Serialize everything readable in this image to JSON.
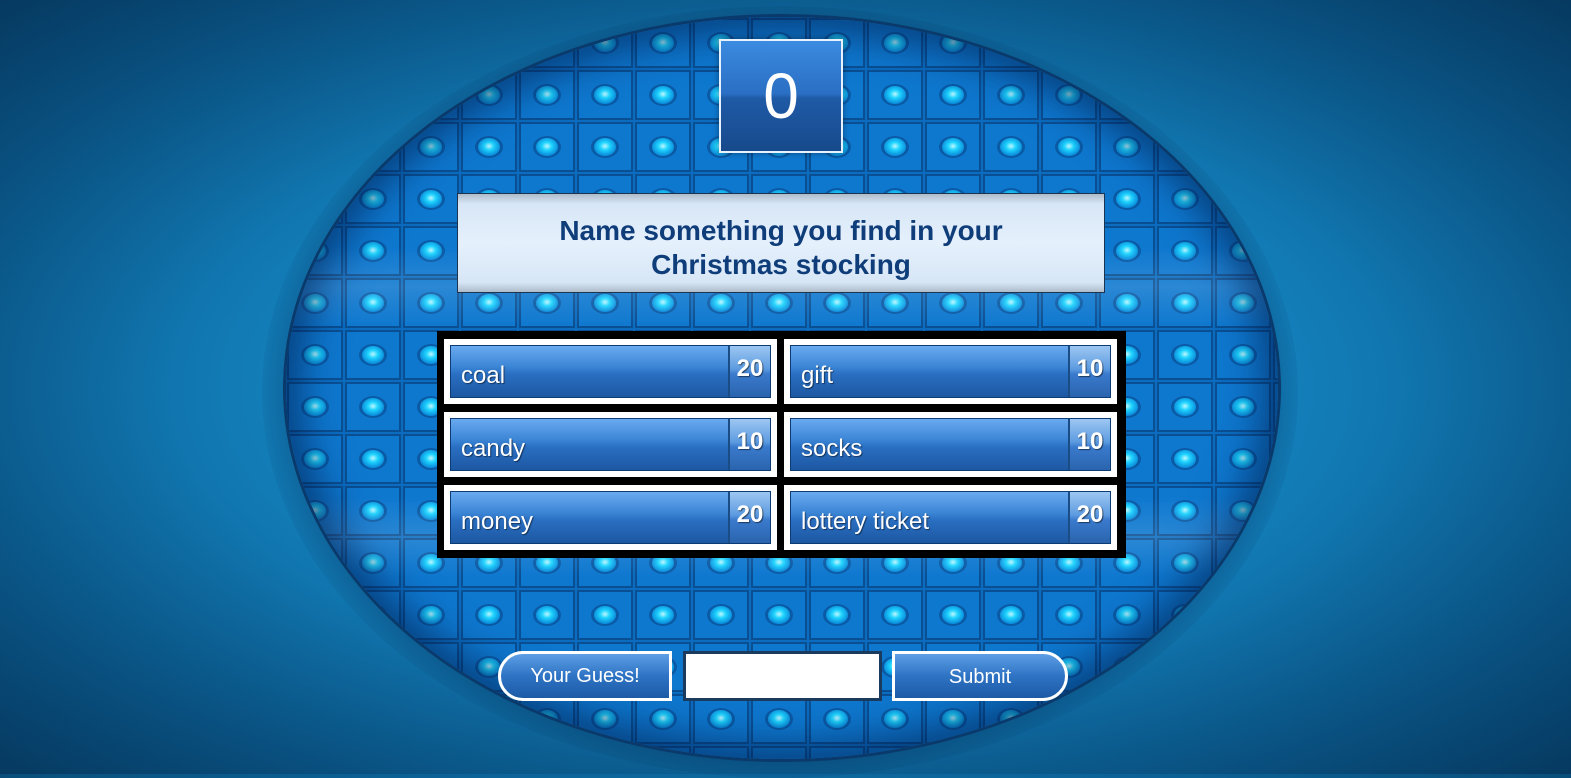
{
  "score": "0",
  "question": "Name something you find in your Christmas stocking",
  "answers": [
    {
      "text": "coal",
      "points": "20"
    },
    {
      "text": "gift",
      "points": "10"
    },
    {
      "text": "candy",
      "points": "10"
    },
    {
      "text": "socks",
      "points": "10"
    },
    {
      "text": "money",
      "points": "20"
    },
    {
      "text": "lottery ticket",
      "points": "20"
    }
  ],
  "guess": {
    "label": "Your Guess!",
    "value": "",
    "submit_label": "Submit"
  },
  "colors": {
    "background": "#137fba",
    "stage": "#0d6fbf",
    "question_text": "#0f3d7a",
    "tile": "#2a6fc2"
  }
}
